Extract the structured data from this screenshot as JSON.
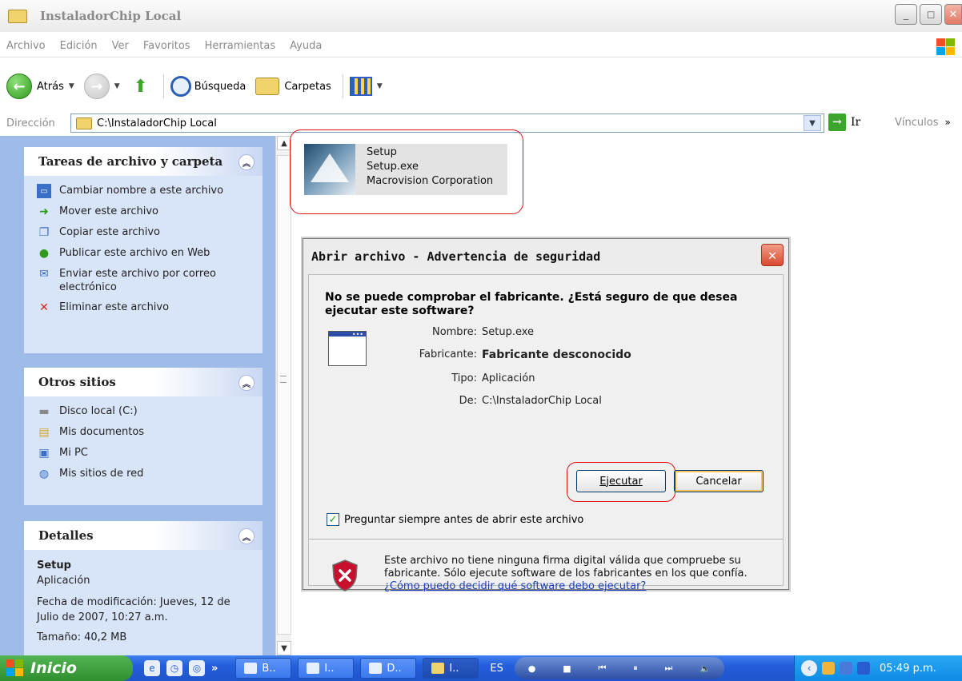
{
  "window": {
    "title": "InstaladorChip Local",
    "controls": {
      "minimize": "_",
      "maximize": "◻",
      "close": "✕"
    }
  },
  "menu": [
    "Archivo",
    "Edición",
    "Ver",
    "Favoritos",
    "Herramientas",
    "Ayuda"
  ],
  "toolbar": {
    "back": "Atrás",
    "search": "Búsqueda",
    "folders": "Carpetas"
  },
  "address": {
    "label": "Dirección",
    "value": "C:\\InstaladorChip Local",
    "go": "Ir",
    "links": "Vínculos"
  },
  "taskpane": {
    "file_tasks": {
      "title": "Tareas de archivo y carpeta",
      "items": [
        {
          "label": "Cambiar nombre a este archivo",
          "icon": "rename-icon"
        },
        {
          "label": "Mover este archivo",
          "icon": "move-icon"
        },
        {
          "label": "Copiar este archivo",
          "icon": "copy-icon"
        },
        {
          "label": "Publicar este archivo en Web",
          "icon": "web-publish-icon"
        },
        {
          "label": "Enviar este archivo por correo electrónico",
          "icon": "email-icon"
        },
        {
          "label": "Eliminar este archivo",
          "icon": "delete-icon"
        }
      ]
    },
    "other_places": {
      "title": "Otros sitios",
      "items": [
        {
          "label": "Disco local (C:)",
          "icon": "drive-icon"
        },
        {
          "label": "Mis documentos",
          "icon": "documents-icon"
        },
        {
          "label": "Mi PC",
          "icon": "computer-icon"
        },
        {
          "label": "Mis sitios de red",
          "icon": "network-icon"
        }
      ]
    },
    "details": {
      "title": "Detalles",
      "name": "Setup",
      "type": "Aplicación",
      "modified": "Fecha de modificación: Jueves, 12 de Julio de 2007, 10:27 a.m.",
      "size": "Tamaño: 40,2 MB"
    }
  },
  "file": {
    "name": "Setup",
    "filename": "Setup.exe",
    "company": "Macrovision Corporation"
  },
  "dialog": {
    "title": "Abrir archivo - Advertencia de seguridad",
    "question": "No se puede comprobar el fabricante. ¿Está seguro de que desea ejecutar este software?",
    "fields": {
      "name_label": "Nombre:",
      "name_value": "Setup.exe",
      "maker_label": "Fabricante:",
      "maker_value": "Fabricante desconocido",
      "type_label": "Tipo:",
      "type_value": "Aplicación",
      "from_label": "De:",
      "from_value": "C:\\InstaladorChip Local"
    },
    "run_button": "Ejecutar",
    "cancel_button": "Cancelar",
    "checkbox_label": "Preguntar siempre antes de abrir este archivo",
    "checkbox_checked": true,
    "warning": "Este archivo no tiene ninguna firma digital válida que compruebe su fabricante. Sólo ejecute software de los fabricantes en los que confía.",
    "warning_link": "¿Cómo puedo decidir qué software debo ejecutar?"
  },
  "taskbar": {
    "start": "Inicio",
    "buttons": [
      "B..",
      "I..",
      "D..",
      "I.."
    ],
    "language": "ES",
    "clock": "05:49 p.m."
  },
  "colors": {
    "taskpane_bg": "#9fbbe8",
    "taskbar_blue": "#245edb",
    "start_green": "#2f8f2f",
    "highlight_red": "#e01010"
  }
}
